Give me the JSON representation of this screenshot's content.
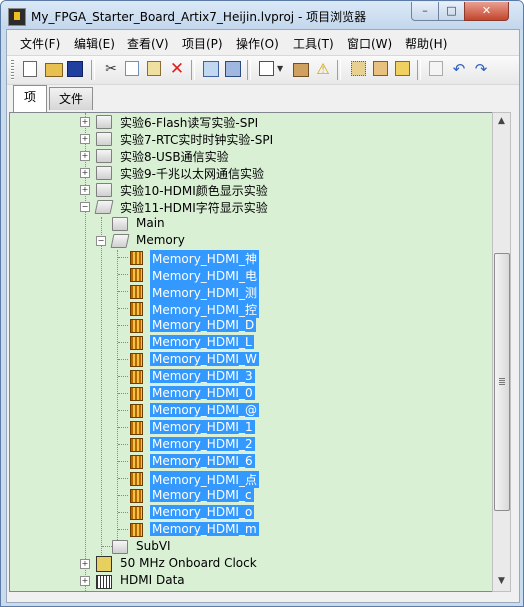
{
  "window": {
    "title": "My_FPGA_Starter_Board_Artix7_Heijin.lvproj - 项目浏览器",
    "minimize": "–",
    "maximize": "□",
    "close": "✕"
  },
  "menu": [
    "文件(F)",
    "编辑(E)",
    "查看(V)",
    "项目(P)",
    "操作(O)",
    "工具(T)",
    "窗口(W)",
    "帮助(H)"
  ],
  "toolbar_icons": [
    "new-icon",
    "open-icon",
    "save-all-icon",
    "cut-icon",
    "copy-icon",
    "paste-icon",
    "delete-icon",
    "project-properties-icon",
    "build-icon",
    "view-dropdown-icon",
    "dependency-icon",
    "warning-icon",
    "expand-icon",
    "collapse-icon",
    "refresh-icon",
    "arrow-icon",
    "undo-icon",
    "redo-icon"
  ],
  "tabs": [
    "项",
    "文件"
  ],
  "tree": {
    "experiments": [
      "实验6-Flash读写实验-SPI",
      "实验7-RTC实时时钟实验-SPI",
      "实验8-USB通信实验",
      "实验9-千兆以太网通信实验",
      "实验10-HDMI颜色显示实验",
      "实验11-HDMI字符显示实验"
    ],
    "main": "Main",
    "memory": "Memory",
    "memory_items": [
      "Memory_HDMI_神",
      "Memory_HDMI_电",
      "Memory_HDMI_测",
      "Memory_HDMI_控",
      "Memory_HDMI_D",
      "Memory_HDMI_L",
      "Memory_HDMI_W",
      "Memory_HDMI_3",
      "Memory_HDMI_0",
      "Memory_HDMI_@",
      "Memory_HDMI_1",
      "Memory_HDMI_2",
      "Memory_HDMI_6",
      "Memory_HDMI_点",
      "Memory_HDMI_c",
      "Memory_HDMI_o",
      "Memory_HDMI_m"
    ],
    "subvi": "SubVI",
    "clock": "50 MHz Onboard Clock",
    "hdmi_data": "HDMI Data"
  },
  "colors": {
    "tree_bg": "#d9f0d5",
    "selection": "#3399ff"
  }
}
